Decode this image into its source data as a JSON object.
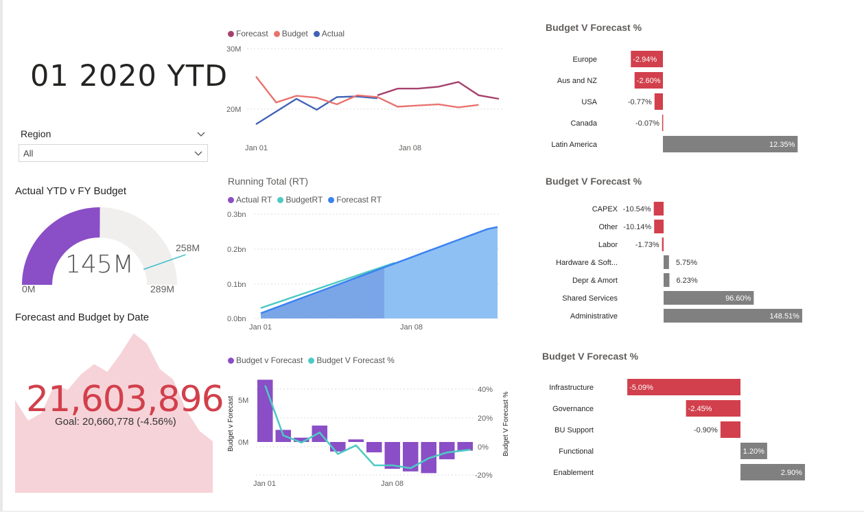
{
  "title": "01 2020 YTD",
  "slicer": {
    "label": "Region",
    "value": "All"
  },
  "gauge": {
    "title": "Actual YTD v FY Budget",
    "value_label": "145M",
    "min_label": "0M",
    "max_label": "289M",
    "target_label": "258M",
    "value": 145,
    "min": 0,
    "max": 289,
    "target": 258,
    "fill_color": "#8a4ec6",
    "track_color": "#f0efee",
    "target_color": "#3fc1c9"
  },
  "kpi": {
    "title": "Forecast and Budget by Date",
    "value": "21,603,896",
    "indicator": "!",
    "goal": "Goal: 20,660,778 (-4.56%)",
    "color": "#d1404c",
    "trend_color": "#f6d3d8",
    "trend_values": [
      36,
      28,
      31,
      42,
      40,
      46,
      50,
      47,
      54,
      62,
      58,
      48,
      44,
      32,
      24,
      20
    ]
  },
  "line_chart": {
    "legend": [
      "Forecast",
      "Budget",
      "Actual"
    ],
    "colors": {
      "Forecast": "#a5416d",
      "Budget": "#e8736f",
      "Actual": "#3f62b6"
    },
    "y_ticks": [
      "30M",
      "20M"
    ],
    "x_ticks": [
      "Jan 01",
      "Jan 08"
    ]
  },
  "running_chart": {
    "title": "Running Total (RT)",
    "legend": [
      "Actual RT",
      "BudgetRT",
      "Forecast RT"
    ],
    "colors": {
      "Actual RT": "#8a4ec6",
      "BudgetRT": "#4ec9c4",
      "Forecast RT": "#3b82f0"
    },
    "y_ticks": [
      "0.3bn",
      "0.2bn",
      "0.1bn",
      "0.0bn"
    ],
    "x_ticks": [
      "Jan 01",
      "Jan 08"
    ]
  },
  "combo_chart": {
    "legend": [
      "Budget v Forecast",
      "Budget V Forecast %"
    ],
    "colors": {
      "Budget v Forecast": "#8a4ec6",
      "Budget V Forecast %": "#4ec9c4"
    },
    "y_left_ticks": [
      "5M",
      "0M"
    ],
    "y_right_ticks": [
      "40%",
      "20%",
      "0%",
      "-20%"
    ],
    "y_left_label": "Budget v Forecast",
    "y_right_label": "Budget V Forecast %",
    "x_ticks": [
      "Jan 01",
      "Jan 08"
    ]
  },
  "chart_data": [
    {
      "type": "line",
      "x": [
        "Jan 01",
        "Jan 02",
        "Jan 03",
        "Jan 04",
        "Jan 05",
        "Jan 06",
        "Jan 07",
        "Jan 08",
        "Jan 09",
        "Jan 10",
        "Jan 11",
        "Jan 12",
        "Jan 13"
      ],
      "ylim": [
        16,
        30
      ],
      "y_unit": "M",
      "series": [
        {
          "name": "Forecast",
          "values": [
            null,
            null,
            null,
            null,
            null,
            null,
            22.3,
            23.4,
            23.4,
            23.7,
            24.5,
            22.3,
            21.7
          ]
        },
        {
          "name": "Budget",
          "values": [
            25.4,
            21.1,
            22.2,
            21.9,
            20.8,
            22.3,
            22.0,
            20.4,
            20.6,
            20.8,
            20.3,
            20.7,
            null
          ]
        },
        {
          "name": "Actual",
          "values": [
            17.5,
            19.6,
            21.7,
            19.9,
            22.0,
            22.1,
            21.8,
            null,
            null,
            null,
            null,
            null,
            null
          ]
        }
      ]
    },
    {
      "type": "area",
      "title": "Running Total (RT)",
      "x_count": 14,
      "ylim": [
        0,
        0.3
      ],
      "y_unit": "bn",
      "series": [
        {
          "name": "Actual RT",
          "values": [
            0.015,
            0.026,
            0.037,
            0.048,
            0.059,
            0.07,
            0.081,
            0.092,
            0.103,
            0.114,
            0.125,
            0.136,
            0.147,
            null
          ]
        },
        {
          "name": "BudgetRT",
          "values": [
            0.028,
            0.038,
            0.048,
            0.058,
            0.068,
            0.078,
            0.088,
            0.098,
            0.108,
            0.118,
            0.128,
            0.138,
            0.148,
            0.158
          ]
        },
        {
          "name": "Forecast RT",
          "values": [
            0.015,
            0.026,
            0.037,
            0.048,
            0.059,
            0.07,
            0.081,
            0.092,
            0.103,
            0.114,
            0.125,
            0.136,
            0.147,
            0.158,
            0.169,
            0.18,
            0.191,
            0.202,
            0.213,
            0.224,
            0.235,
            0.246,
            0.257,
            0.263
          ]
        }
      ]
    },
    {
      "type": "bar",
      "x_count": 12,
      "series": [
        {
          "name": "Budget v Forecast",
          "axis": "left",
          "unit": "M",
          "ylim": [
            -2.7,
            7.5
          ],
          "values": [
            7.2,
            1.4,
            0.5,
            1.9,
            -1.1,
            0.3,
            -1.2,
            -3.1,
            -3.4,
            -3.6,
            -2.0,
            -1.0
          ]
        },
        {
          "name": "Budget V Forecast %",
          "axis": "right",
          "unit": "%",
          "ylim": [
            -20,
            45
          ],
          "values": [
            43,
            8,
            3,
            10,
            -5,
            1,
            -13,
            -13,
            -15,
            -8,
            -4,
            null
          ]
        }
      ]
    },
    {
      "type": "bar",
      "title": "Budget V Forecast %",
      "categories": [
        "Europe",
        "Aus and NZ",
        "USA",
        "Canada",
        "Latin America"
      ],
      "values": [
        -2.94,
        -2.6,
        -0.77,
        -0.07,
        12.35
      ],
      "labels": [
        "-2.94%",
        "-2.60%",
        "-0.77%",
        "-0.07%",
        "12.35%"
      ]
    },
    {
      "type": "bar",
      "title": "Budget V Forecast %",
      "categories": [
        "CAPEX",
        "Other",
        "Labor",
        "Hardware & Soft...",
        "Depr & Amort",
        "Shared Services",
        "Administrative"
      ],
      "values": [
        -10.54,
        -10.14,
        -1.73,
        5.75,
        6.23,
        96.6,
        148.51
      ],
      "labels": [
        "-10.54%",
        "-10.14%",
        "-1.73%",
        "5.75%",
        "6.23%",
        "96.60%",
        "148.51%"
      ]
    },
    {
      "type": "bar",
      "title": "Budget V Forecast %",
      "categories": [
        "Infrastructure",
        "Governance",
        "BU Support",
        "Functional",
        "Enablement"
      ],
      "values": [
        -5.09,
        -2.45,
        -0.9,
        1.2,
        2.9
      ],
      "labels": [
        "-5.09%",
        "-2.45%",
        "-0.90%",
        "1.20%",
        "2.90%"
      ]
    }
  ],
  "bar_colors": {
    "negative": "#d1404c",
    "positive": "#808080"
  }
}
